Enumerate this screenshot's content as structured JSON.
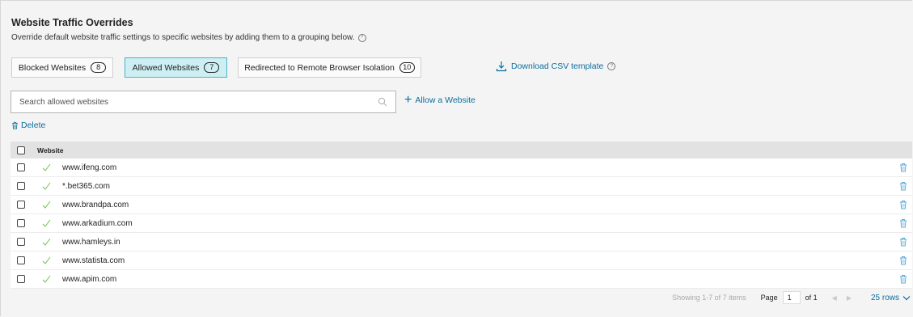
{
  "header": {
    "title": "Website Traffic Overrides",
    "subtitle": "Override default website traffic settings to specific websites by adding them to a grouping below.",
    "help_glyph": "?"
  },
  "tabs": [
    {
      "label": "Blocked Websites",
      "count": "8",
      "active": false
    },
    {
      "label": "Allowed Websites",
      "count": "7",
      "active": true
    },
    {
      "label": "Redirected to Remote Browser Isolation",
      "count": "10",
      "active": false
    }
  ],
  "download": {
    "label": "Download CSV template",
    "icon": "download-icon"
  },
  "search": {
    "placeholder": "Search allowed websites",
    "value": ""
  },
  "actions": {
    "allow_label": "Allow a Website",
    "plus": "+",
    "delete_label": "Delete"
  },
  "table": {
    "column_website": "Website",
    "rows": [
      {
        "website": "www.ifeng.com"
      },
      {
        "website": "*.bet365.com"
      },
      {
        "website": "www.brandpa.com"
      },
      {
        "website": "www.arkadium.com"
      },
      {
        "website": "www.hamleys.in"
      },
      {
        "website": "www.statista.com"
      },
      {
        "website": "www.apim.com"
      }
    ]
  },
  "pagination": {
    "showing": "Showing 1-7 of 7 items",
    "page_label": "Page",
    "page_value": "1",
    "of_label": "of 1",
    "prev_glyph": "◀",
    "next_glyph": "▶",
    "rows_label": "25 rows"
  },
  "colors": {
    "accent": "#0b6e9c",
    "active_tab_bg": "#cdeef2",
    "active_tab_border": "#4bb4c2",
    "check_green": "#6cc24a",
    "trash_blue": "#5aa9d6"
  }
}
